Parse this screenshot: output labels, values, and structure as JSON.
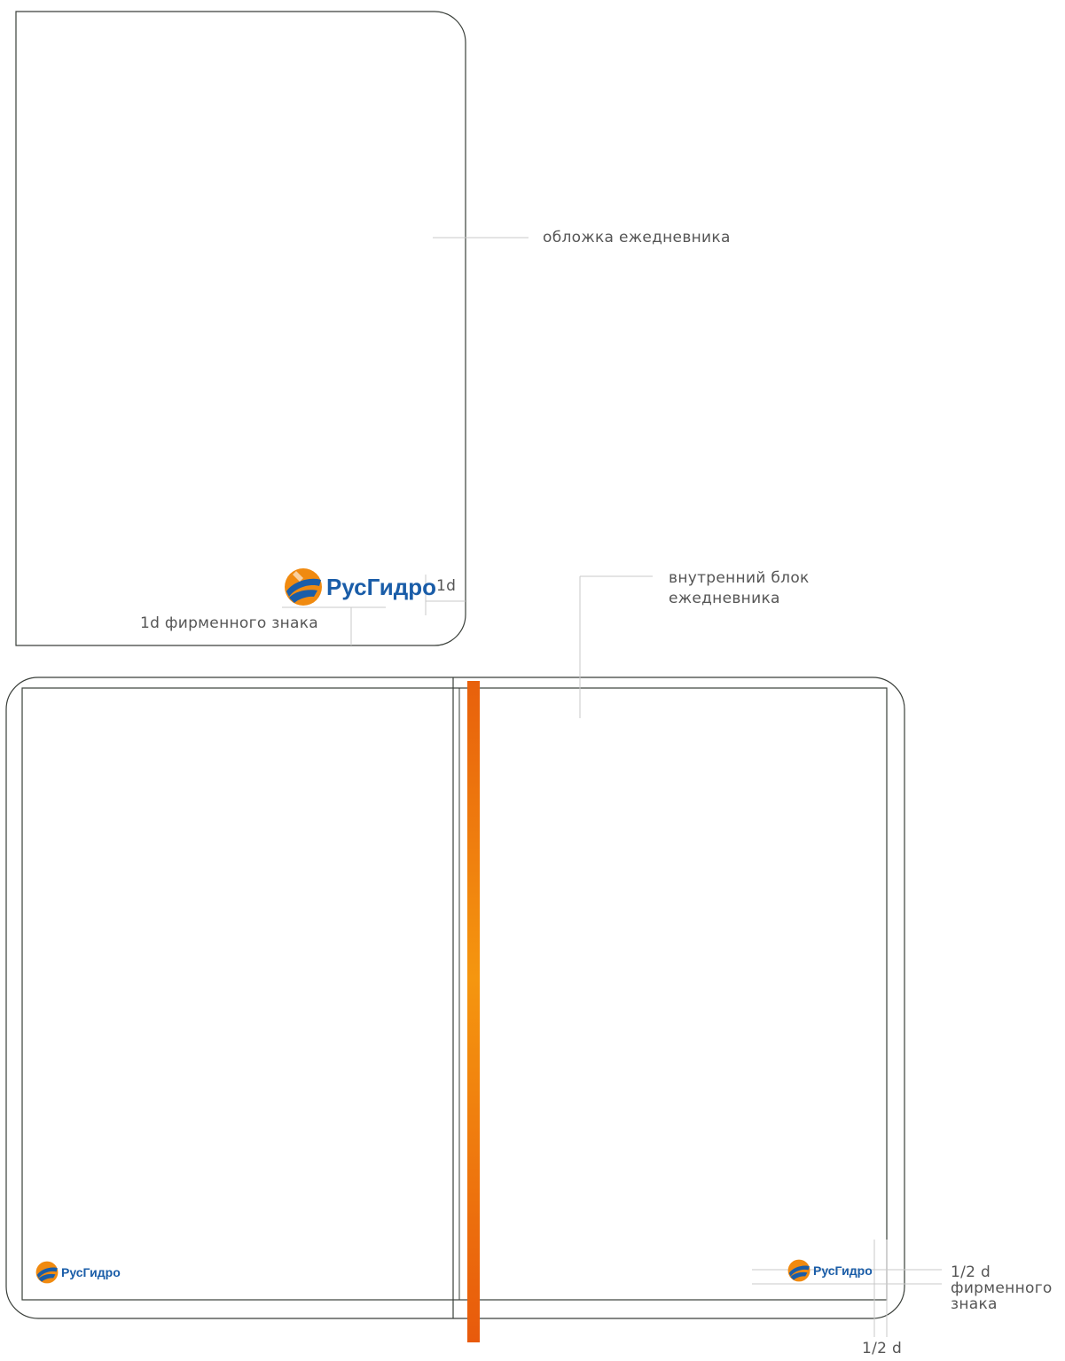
{
  "brand": {
    "logo_text": "РусГидро",
    "colors": {
      "blue": "#1a5da8",
      "orange": "#f08a10",
      "ribbon_dark": "#e85a0c",
      "outline": "#3a3f3a",
      "guide": "#c8c8c8"
    }
  },
  "labels": {
    "cover": "обложка ежедневника",
    "inner_block_line1": "внутренний блок",
    "inner_block_line2": "ежедневника",
    "spacing_1d": "1d",
    "spacing_1d_logo": "1d фирменного знака",
    "half_d_line1": "1/2 d",
    "half_d_line2": "фирменного",
    "half_d_line3": "знака",
    "half_d_bottom": "1/2 d"
  }
}
